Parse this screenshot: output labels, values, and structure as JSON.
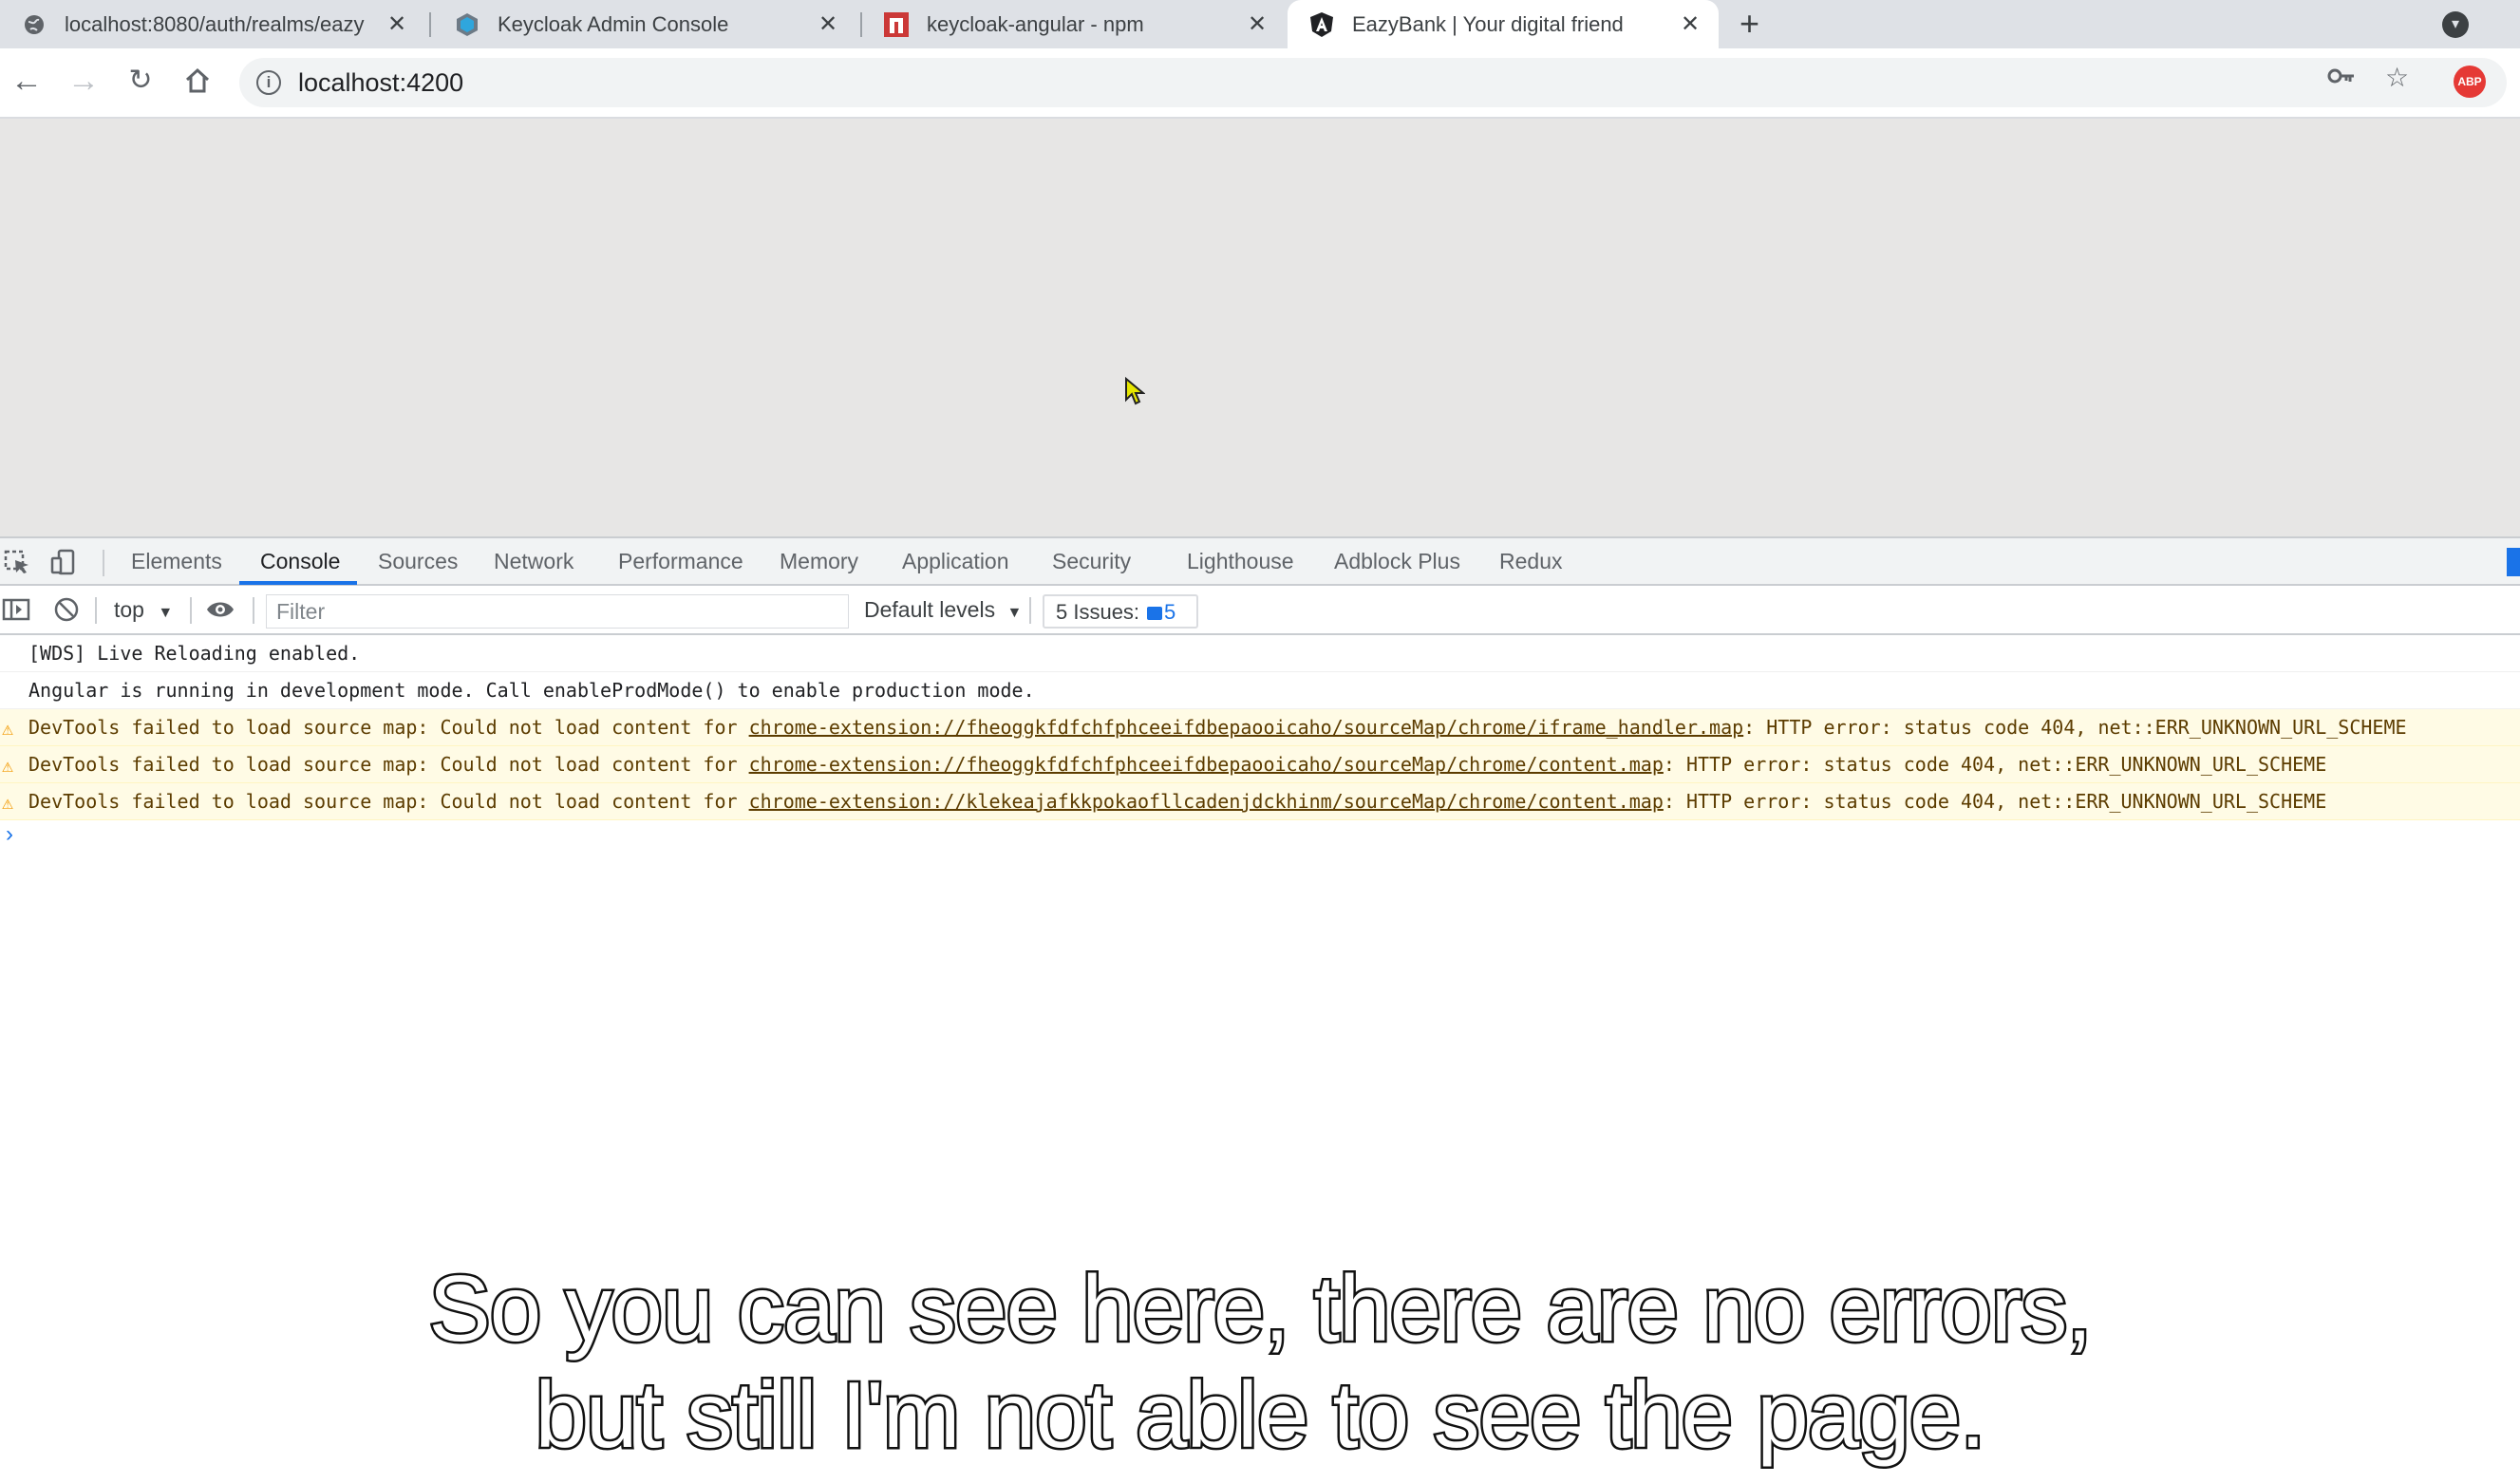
{
  "browser": {
    "tabs": [
      {
        "title": "localhost:8080/auth/realms/eazy",
        "icon": "globe-icon"
      },
      {
        "title": "Keycloak Admin Console",
        "icon": "keycloak-icon"
      },
      {
        "title": "keycloak-angular - npm",
        "icon": "npm-icon"
      },
      {
        "title": "EazyBank | Your digital friend",
        "icon": "angular-icon",
        "active": true
      }
    ],
    "url": "localhost:4200",
    "extension_badge": "ABP"
  },
  "devtools": {
    "tabs": [
      "Elements",
      "Console",
      "Sources",
      "Network",
      "Performance",
      "Memory",
      "Application",
      "Security",
      "Lighthouse",
      "Adblock Plus",
      "Redux"
    ],
    "active_tab": "Console",
    "console_toolbar": {
      "context": "top",
      "filter_placeholder": "Filter",
      "levels": "Default levels",
      "issues_label": "5 Issues:",
      "issues_count": "5"
    },
    "logs": [
      {
        "type": "info",
        "text": "[WDS] Live Reloading enabled."
      },
      {
        "type": "info",
        "text": "Angular is running in development mode. Call enableProdMode() to enable production mode."
      },
      {
        "type": "warning",
        "prefix": "DevTools failed to load source map: Could not load content for ",
        "link": "chrome-extension://fheoggkfdfchfphceeifdbepaooicaho/sourceMap/chrome/iframe_handler.map",
        "suffix": ": HTTP error: status code 404, net::ERR_UNKNOWN_URL_SCHEME"
      },
      {
        "type": "warning",
        "prefix": "DevTools failed to load source map: Could not load content for ",
        "link": "chrome-extension://fheoggkfdfchfphceeifdbepaooicaho/sourceMap/chrome/content.map",
        "suffix": ": HTTP error: status code 404, net::ERR_UNKNOWN_URL_SCHEME"
      },
      {
        "type": "warning",
        "prefix": "DevTools failed to load source map: Could not load content for ",
        "link": "chrome-extension://klekeajafkkpokaofllcadenjdckhinm/sourceMap/chrome/content.map",
        "suffix": ": HTTP error: status code 404, net::ERR_UNKNOWN_URL_SCHEME"
      }
    ],
    "prompt_symbol": "›"
  },
  "caption": {
    "line1": "So you can see here, there are no errors,",
    "line2": "but still I'm not able to see the page."
  }
}
